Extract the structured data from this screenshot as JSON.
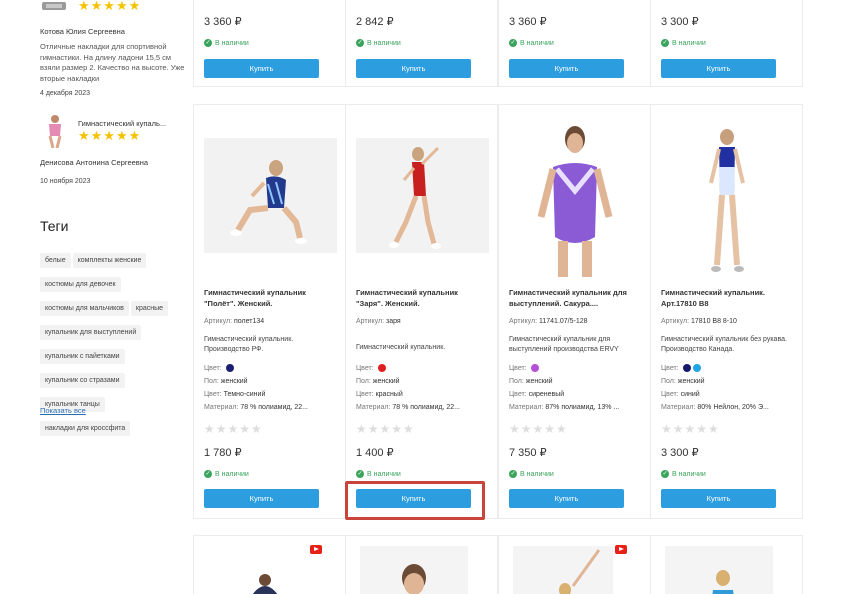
{
  "reviews": [
    {
      "author": "Котова Юлия Сергеевна",
      "text": "Отличные накладки для спортивной гимнастики. На длину ладони 15,5 см взяли размер 2. Качество на высоте. Уже вторые накладки",
      "date": "4 декабря 2023",
      "stars": "★★★★★"
    },
    {
      "product": "Гимнастический купаль...",
      "author": "Денисова Антонина Сергеевна",
      "date": "10 ноября 2023",
      "stars": "★★★★★"
    }
  ],
  "tags_title": "Теги",
  "tags": [
    "белые",
    "комплекты женские",
    "костюмы для девочек",
    "костюмы для мальчиков",
    "красные",
    "купальник для выступлений",
    "купальник с пайетками",
    "купальник со стразами",
    "купальник танцы",
    "накладки для кроссфита"
  ],
  "show_all": "Показать все",
  "top_row": [
    {
      "price": "3 360 ₽",
      "stock": "В наличии",
      "buy": "Купить"
    },
    {
      "price": "2 842 ₽",
      "stock": "В наличии",
      "buy": "Купить"
    },
    {
      "price": "3 360 ₽",
      "stock": "В наличии",
      "buy": "Купить"
    },
    {
      "price": "3 300 ₽",
      "stock": "В наличии",
      "buy": "Купить"
    }
  ],
  "products": [
    {
      "title": "Гимнастический купальник \"Полёт\". Женский.",
      "article_label": "Артикул:",
      "article": "полет134",
      "desc": "Гимнастический купальник. Производство РФ.",
      "color_label": "Цвет:",
      "colors": [
        "#1b1d6e"
      ],
      "gender_label": "Пол:",
      "gender": "женский",
      "color_name_label": "Цвет:",
      "color_name": "Темно-синий",
      "material_label": "Материал:",
      "material": "78 % полиамид, 22...",
      "rating": "★★★★★",
      "price": "1 780 ₽",
      "stock": "В наличии",
      "buy": "Купить"
    },
    {
      "title": "Гимнастический купальник \"Заря\". Женский.",
      "article_label": "Артикул:",
      "article": "заря",
      "desc": "Гимнастический купальник.",
      "color_label": "Цвет:",
      "colors": [
        "#e02020"
      ],
      "gender_label": "Пол:",
      "gender": "женский",
      "color_name_label": "Цвет:",
      "color_name": "красный",
      "material_label": "Материал:",
      "material": "78 % полиамид, 22...",
      "rating": "★★★★★",
      "price": "1 400 ₽",
      "stock": "В наличии",
      "buy": "Купить"
    },
    {
      "title": "Гимнастический купальник для выступлений. Сакура....",
      "article_label": "Артикул:",
      "article": "11741.07/5-128",
      "desc": "Гимнастический купальник для выступлений производства ERVY",
      "color_label": "Цвет:",
      "colors": [
        "#b44fd8"
      ],
      "gender_label": "Пол:",
      "gender": "женский",
      "color_name_label": "Цвет:",
      "color_name": "сиреневый",
      "material_label": "Материал:",
      "material": "87% полиамид, 13% ...",
      "rating": "★★★★★",
      "price": "7 350 ₽",
      "stock": "В наличии",
      "buy": "Купить"
    },
    {
      "title": "Гимнастический купальник. Арт.17810 B8",
      "article_label": "Артикул:",
      "article": "17810 B8 8-10",
      "desc": "Гимнастический купальник без рукава. Производство Канада.",
      "color_label": "Цвет:",
      "colors": [
        "#16186a",
        "#22a5e6"
      ],
      "gender_label": "Пол:",
      "gender": "женский",
      "color_name_label": "Цвет:",
      "color_name": "синий",
      "material_label": "Материал:",
      "material": "80% Нейлон, 20% Э...",
      "rating": "★★★★★",
      "price": "3 300 ₽",
      "stock": "В наличии",
      "buy": "Купить"
    }
  ],
  "colors": {
    "accent": "#2c9ddf",
    "in_stock": "#3aa35c",
    "highlight": "#c9443b",
    "star": "#f5c200"
  }
}
